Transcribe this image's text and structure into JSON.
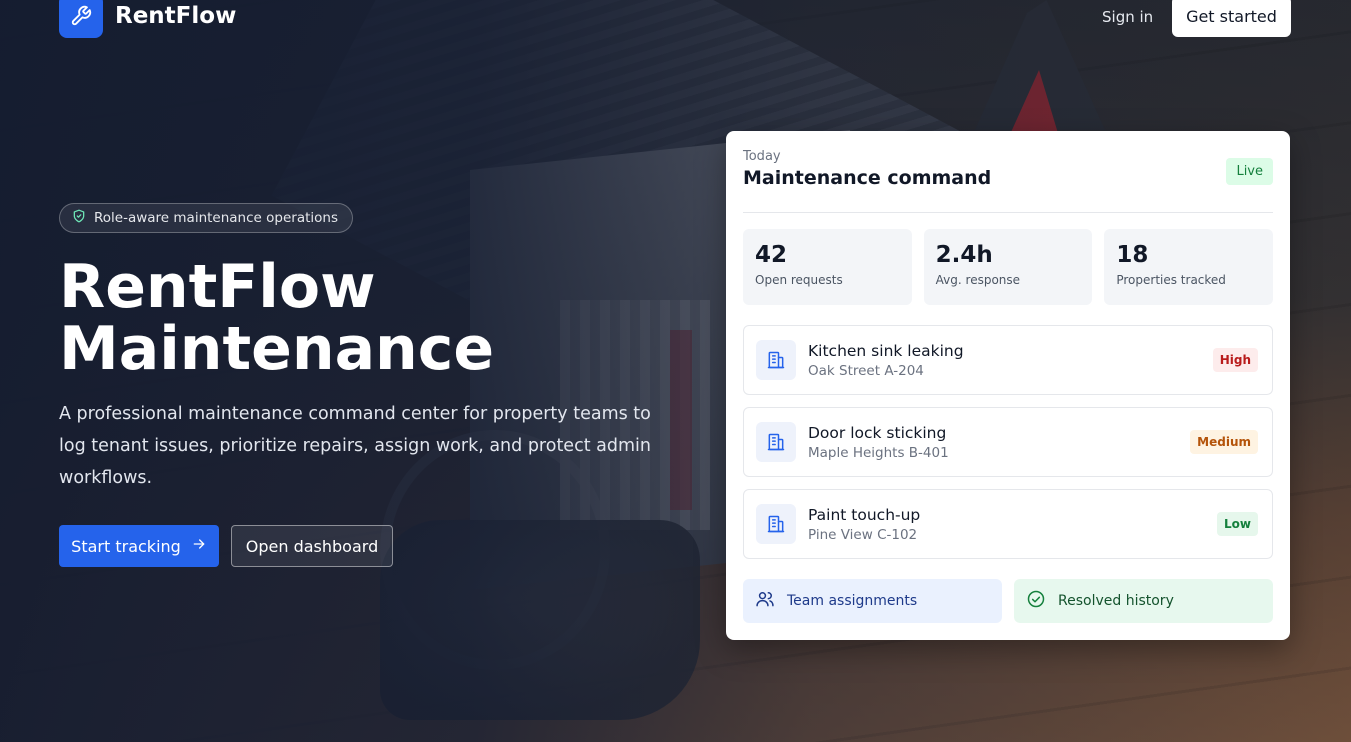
{
  "nav": {
    "brand": "RentFlow",
    "sign_in": "Sign in",
    "get_started": "Get started"
  },
  "hero": {
    "pill": "Role-aware maintenance operations",
    "title_line1": "RentFlow",
    "title_line2": "Maintenance",
    "description": "A professional maintenance command center for property teams to log tenant issues, prioritize repairs, assign work, and protect admin workflows.",
    "primary_cta": "Start tracking",
    "secondary_cta": "Open dashboard"
  },
  "card": {
    "eyebrow": "Today",
    "title": "Maintenance command",
    "status": "Live",
    "stats": [
      {
        "value": "42",
        "label": "Open requests"
      },
      {
        "value": "2.4h",
        "label": "Avg. response"
      },
      {
        "value": "18",
        "label": "Properties tracked"
      }
    ],
    "requests": [
      {
        "title": "Kitchen sink leaking",
        "location": "Oak Street A-204",
        "priority": "High"
      },
      {
        "title": "Door lock sticking",
        "location": "Maple Heights B-401",
        "priority": "Medium"
      },
      {
        "title": "Paint touch-up",
        "location": "Pine View C-102",
        "priority": "Low"
      }
    ],
    "actions": {
      "team": "Team assignments",
      "resolved": "Resolved history"
    }
  },
  "colors": {
    "accent": "#2563eb",
    "high": "#b91c1c",
    "medium": "#b45309",
    "low": "#15803d"
  },
  "icons": {
    "brand": "wrench-icon",
    "pill": "shield-check-icon",
    "cta": "arrow-right-icon",
    "request": "building-icon",
    "team": "users-icon",
    "resolved": "check-circle-icon"
  }
}
